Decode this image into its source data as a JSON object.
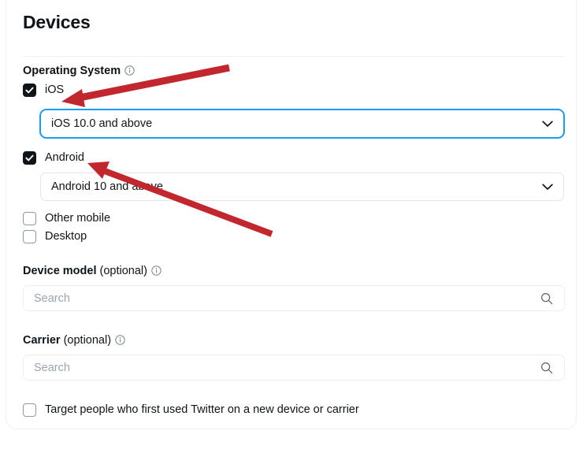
{
  "page": {
    "title": "Devices"
  },
  "operating_system": {
    "label": "Operating System",
    "info_icon": "info-circle-icon",
    "options": [
      {
        "id": "ios",
        "label": "iOS",
        "checked": true,
        "checkbox_icon": "checkbox-checked-icon"
      },
      {
        "id": "android",
        "label": "Android",
        "checked": true,
        "checkbox_icon": "checkbox-checked-icon"
      },
      {
        "id": "other-mobile",
        "label": "Other mobile",
        "checked": false,
        "checkbox_icon": "checkbox-unchecked-icon"
      },
      {
        "id": "desktop",
        "label": "Desktop",
        "checked": false,
        "checkbox_icon": "checkbox-unchecked-icon"
      }
    ],
    "ios_version_select": {
      "value": "iOS 10.0 and above",
      "focused": true,
      "chevron_icon": "chevron-down-icon"
    },
    "android_version_select": {
      "value": "Android 10 and above",
      "focused": false,
      "chevron_icon": "chevron-down-icon"
    }
  },
  "device_model": {
    "label": "Device model",
    "optional_suffix": "(optional)",
    "info_icon": "info-circle-icon",
    "search_placeholder": "Search",
    "search_value": "",
    "search_icon": "search-icon"
  },
  "carrier": {
    "label": "Carrier",
    "optional_suffix": "(optional)",
    "info_icon": "info-circle-icon",
    "search_placeholder": "Search",
    "search_value": "",
    "search_icon": "search-icon"
  },
  "new_device_option": {
    "label": "Target people who first used Twitter on a new device or carrier",
    "checked": false,
    "checkbox_icon": "checkbox-unchecked-icon"
  },
  "annotations": {
    "arrow_1": {
      "name": "red-arrow-pointing-to-ios-checkbox"
    },
    "arrow_2": {
      "name": "red-arrow-pointing-to-android-checkbox"
    }
  },
  "colors": {
    "accent_blue": "#1d9bf0",
    "text_primary": "#0f1419",
    "text_placeholder": "#9aa5b1",
    "border_light": "#e3e6e8",
    "annotation_red": "#c1272d",
    "checkbox_checked": "#0f1419"
  }
}
